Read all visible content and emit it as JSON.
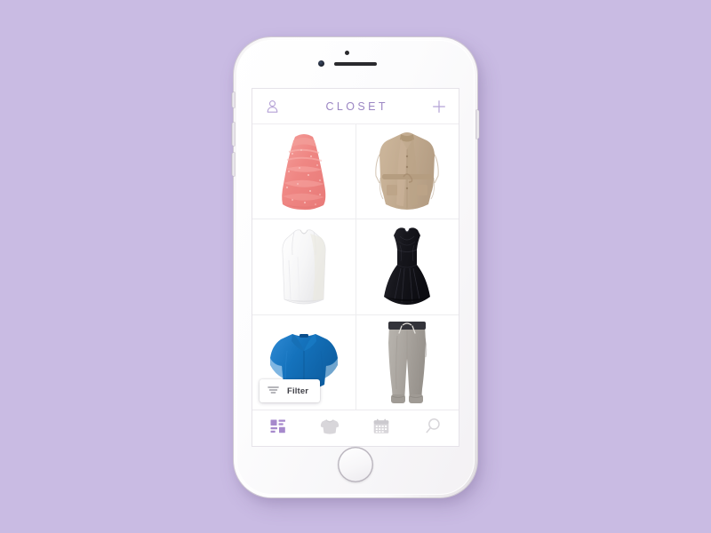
{
  "background_color": "#c9bbe3",
  "device": {
    "name": "white-smartphone-mockup",
    "body_color": "#fdfdfd",
    "hardware": {
      "earpiece": "earpiece-speaker",
      "front_camera": "front-camera",
      "proximity_sensor": "proximity-sensor",
      "home_button": "home-button",
      "silent_switch": "silent-switch",
      "volume_up": "volume-up-button",
      "volume_down": "volume-down-button",
      "power": "power-button"
    }
  },
  "app": {
    "header": {
      "title": "CLOSET",
      "title_color": "#9b86c3",
      "profile_icon": "person-icon",
      "add_icon": "plus-icon"
    },
    "grid": {
      "columns": 2,
      "rows": 3,
      "divider_color": "#ededef",
      "items": [
        {
          "name": "coral-ruffle-dress",
          "label": "Coral ruffled strapless dress",
          "color": "#ef8683"
        },
        {
          "name": "beige-belted-jacket",
          "label": "Beige belted trench jacket",
          "color": "#c2ab90"
        },
        {
          "name": "white-tank-top",
          "label": "White sleeveless tank top",
          "color": "#f2f2f2"
        },
        {
          "name": "black-flare-dress",
          "label": "Black fit-and-flare dress",
          "color": "#16161c"
        },
        {
          "name": "blue-flutter-blouse",
          "label": "Blue v-neck flutter blouse",
          "color": "#1472bc"
        },
        {
          "name": "grey-jogger-pants",
          "label": "Grey drawstring jogger pants",
          "color": "#a9a49e"
        }
      ]
    },
    "filter_button": {
      "label": "Filter",
      "icon": "filter-lines-icon",
      "text_color": "#3f3f46"
    },
    "tab_bar": {
      "active_color": "#a689cc",
      "inactive_color": "#d8d6da",
      "tabs": [
        {
          "name": "tab-closet",
          "icon": "grid-blocks-icon",
          "label": "Closet",
          "active": true
        },
        {
          "name": "tab-outfits",
          "icon": "sweater-icon",
          "label": "Outfits",
          "active": false
        },
        {
          "name": "tab-calendar",
          "icon": "calendar-icon",
          "label": "Calendar",
          "active": false
        },
        {
          "name": "tab-search",
          "icon": "magnifier-icon",
          "label": "Search",
          "active": false
        }
      ]
    }
  }
}
